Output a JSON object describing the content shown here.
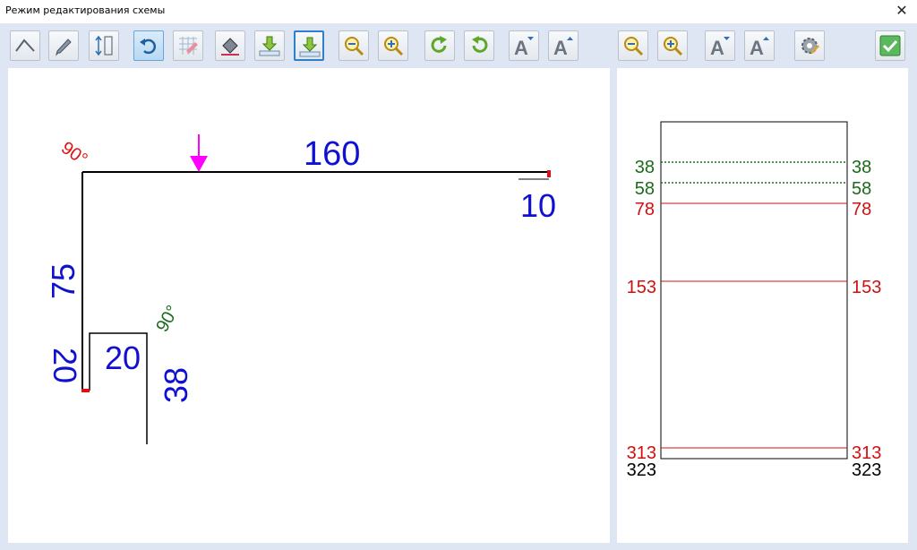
{
  "window": {
    "title": "Режим редактирования схемы",
    "close_glyph": "✕"
  },
  "toolbar": {
    "buttons": [
      {
        "icon": "bend-tool-icon"
      },
      {
        "icon": "pencil-icon"
      },
      {
        "icon": "height-dimension-icon"
      },
      {
        "icon": "undo-arrow-icon",
        "state": "active"
      },
      {
        "icon": "eraser-grid-icon"
      },
      {
        "icon": "paint-bucket-icon"
      },
      {
        "icon": "download-arrow-icon"
      },
      {
        "icon": "download-arrow-icon",
        "state": "focused"
      },
      {
        "icon": "zoom-out-icon"
      },
      {
        "icon": "zoom-in-icon"
      },
      {
        "icon": "rotate-clockwise-icon"
      },
      {
        "icon": "rotate-counterclockwise-icon"
      },
      {
        "icon": "font-decrease-icon"
      },
      {
        "icon": "font-increase-icon"
      },
      {
        "icon": "zoom-out-icon"
      },
      {
        "icon": "zoom-in-icon"
      },
      {
        "icon": "font-decrease-icon"
      },
      {
        "icon": "font-increase-icon"
      },
      {
        "icon": "settings-gear-icon"
      },
      {
        "icon": "confirm-check-icon"
      }
    ]
  },
  "drawing": {
    "top_segment": "160",
    "left_segment": "75",
    "right_flange": "10",
    "bottom_flange": "20",
    "lower_width": "20",
    "lower_height": "38",
    "angle_top": "90°",
    "angle_lower": "90°",
    "colors": {
      "dimension": "#1010d0",
      "angle_red": "#e01010",
      "angle_green": "#1a6b1a",
      "arrow": "#ff00ff"
    }
  },
  "layout_view": {
    "left_labels": [
      {
        "text": "38",
        "color": "#1a6b1a"
      },
      {
        "text": "58",
        "color": "#1a6b1a"
      },
      {
        "text": "78",
        "color": "#d01010"
      },
      {
        "text": "153",
        "color": "#d01010"
      },
      {
        "text": "313",
        "color": "#d01010"
      },
      {
        "text": "323",
        "color": "#000000"
      }
    ],
    "right_labels": [
      {
        "text": "38",
        "color": "#1a6b1a"
      },
      {
        "text": "58",
        "color": "#1a6b1a"
      },
      {
        "text": "78",
        "color": "#d01010"
      },
      {
        "text": "153",
        "color": "#d01010"
      },
      {
        "text": "313",
        "color": "#d01010"
      },
      {
        "text": "323",
        "color": "#000000"
      }
    ]
  }
}
